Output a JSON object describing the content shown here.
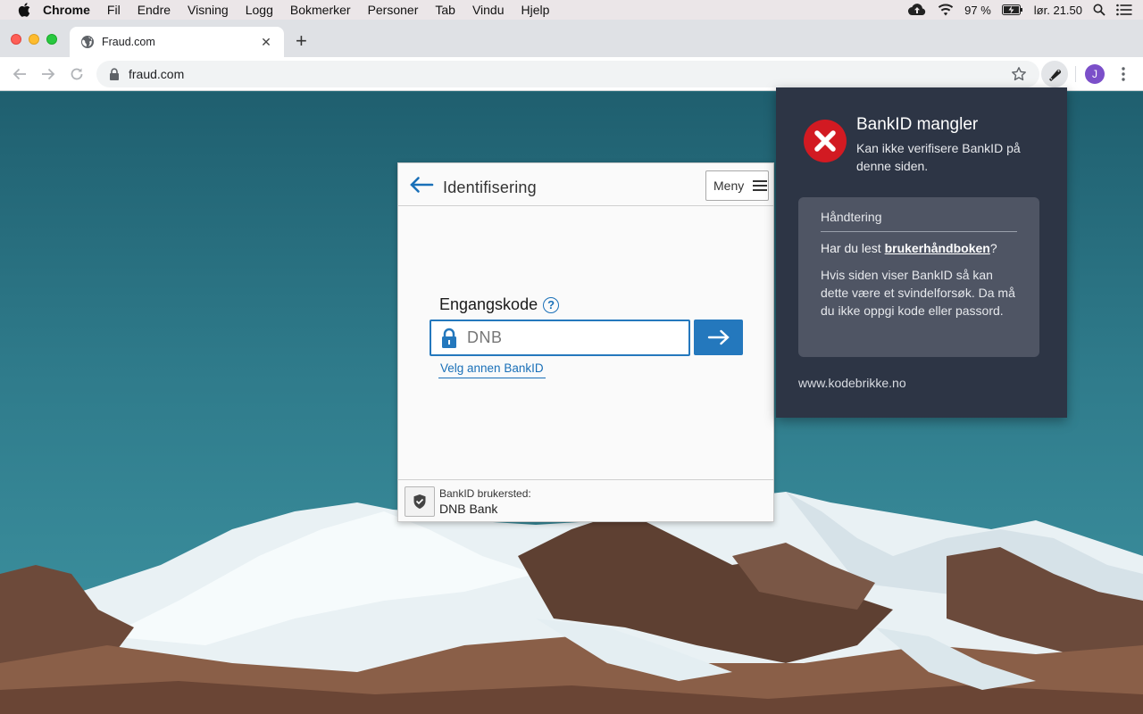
{
  "menubar": {
    "app": "Chrome",
    "items": [
      "Fil",
      "Endre",
      "Visning",
      "Logg",
      "Bokmerker",
      "Personer",
      "Tab",
      "Vindu",
      "Hjelp"
    ],
    "battery": "97 %",
    "clock": "lør. 21.50"
  },
  "browser": {
    "tab_title": "Fraud.com",
    "tab_close": "✕",
    "new_tab": "+",
    "url": "fraud.com",
    "profile_initial": "J"
  },
  "bankid": {
    "header_title": "Identifisering",
    "menu_label": "Meny",
    "field_label": "Engangskode",
    "help": "?",
    "input_placeholder": "DNB",
    "alt_link": "Velg annen BankID",
    "footer_label": "BankID brukersted:",
    "footer_value": "DNB Bank"
  },
  "popup": {
    "title": "BankID mangler",
    "subtitle": "Kan ikke verifisere BankID på denne siden.",
    "card_heading": "Håndtering",
    "question_prefix": "Har du lest ",
    "question_link": "brukerhåndboken",
    "question_suffix": "?",
    "body": "Hvis siden viser BankID så kan dette være et svindelforsøk. Da må du ikke oppgi kode eller passord.",
    "footer_link": "www.kodebrikke.no"
  },
  "colors": {
    "bankid_blue": "#2478bd",
    "popup_bg": "#2d3545",
    "error_red": "#d21a22"
  }
}
